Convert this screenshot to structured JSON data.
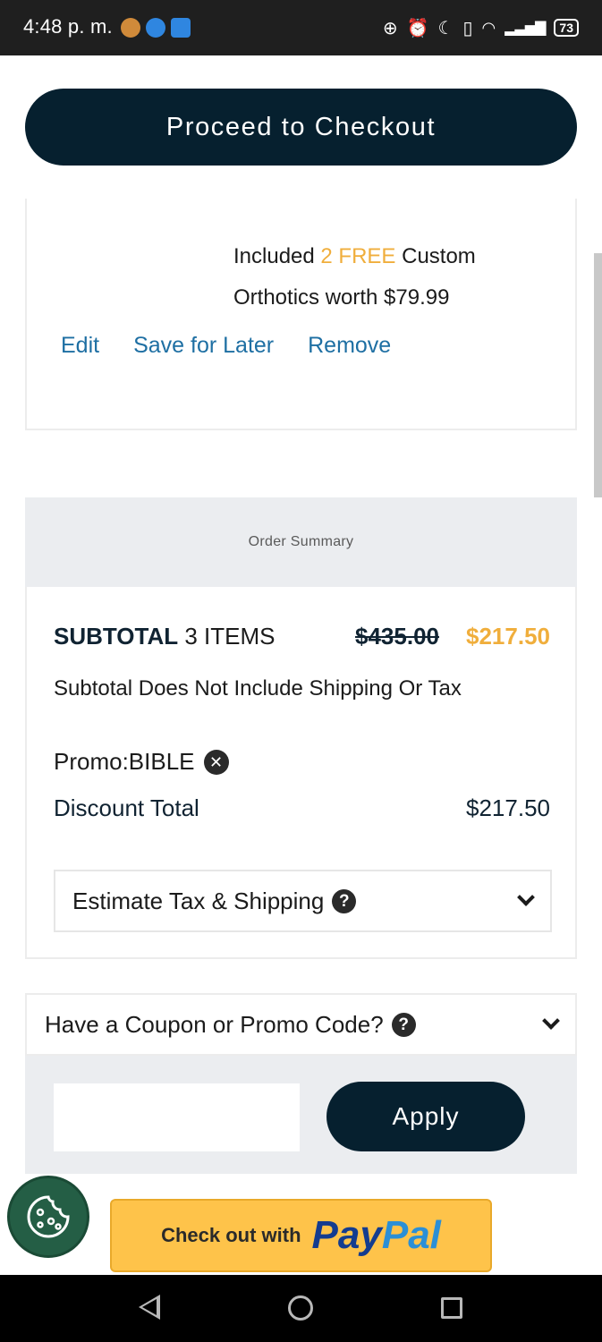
{
  "status_bar": {
    "time": "4:48 p. m.",
    "battery": "73"
  },
  "checkout": {
    "button_label": "Proceed to Checkout"
  },
  "item": {
    "included_prefix": "Included ",
    "included_highlight": "2 FREE",
    "included_suffix": " Custom Orthotics worth $79.99",
    "actions": {
      "edit": "Edit",
      "save_for_later": "Save for Later",
      "remove": "Remove"
    }
  },
  "order_summary": {
    "title": "Order Summary",
    "subtotal_label": "SUBTOTAL",
    "subtotal_items": "3 ITEMS",
    "original_price": "$435.00",
    "sale_price": "$217.50",
    "note": "Subtotal Does Not Include Shipping Or Tax",
    "promo_label": "Promo:BIBLE",
    "discount_label": "Discount Total",
    "discount_value": "$217.50",
    "estimate_label": "Estimate Tax & Shipping"
  },
  "coupon": {
    "header": "Have a Coupon or Promo Code?",
    "input_value": "",
    "apply_label": "Apply"
  },
  "paypal": {
    "prefix": "Check out with",
    "brand_pay": "Pay",
    "brand_pal": "Pal"
  },
  "colors": {
    "primary": "#06202f",
    "accent": "#f0ae3c",
    "link": "#1e6fa3"
  }
}
